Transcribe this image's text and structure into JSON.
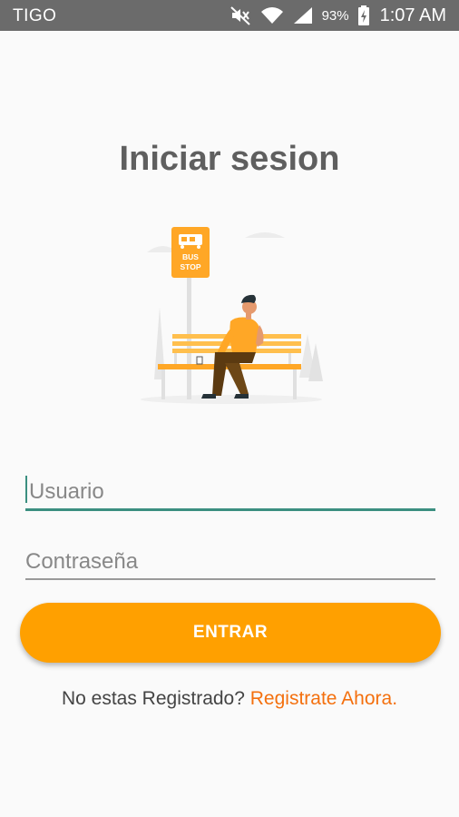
{
  "status_bar": {
    "carrier": "TIGO",
    "battery_percent": "93%",
    "time": "1:07 AM",
    "icons": [
      "mute-icon",
      "wifi-icon",
      "signal-icon",
      "battery-charging-icon"
    ]
  },
  "login": {
    "title": "Iniciar sesion",
    "illustration": {
      "icon": "bus-stop-illustration",
      "sign_line1": "BUS",
      "sign_line2": "STOP"
    },
    "username": {
      "value": "",
      "placeholder": "Usuario"
    },
    "password": {
      "value": "",
      "placeholder": "Contraseña"
    },
    "enter_label": "ENTRAR",
    "register_prompt": "No estas Registrado?",
    "register_link": "Registrate Ahora."
  },
  "colors": {
    "accent": "#ffa000",
    "link": "#f4700e",
    "focus_underline": "#3b8f80",
    "title": "#5f5f5f",
    "status_bar": "#6b6b6b"
  }
}
